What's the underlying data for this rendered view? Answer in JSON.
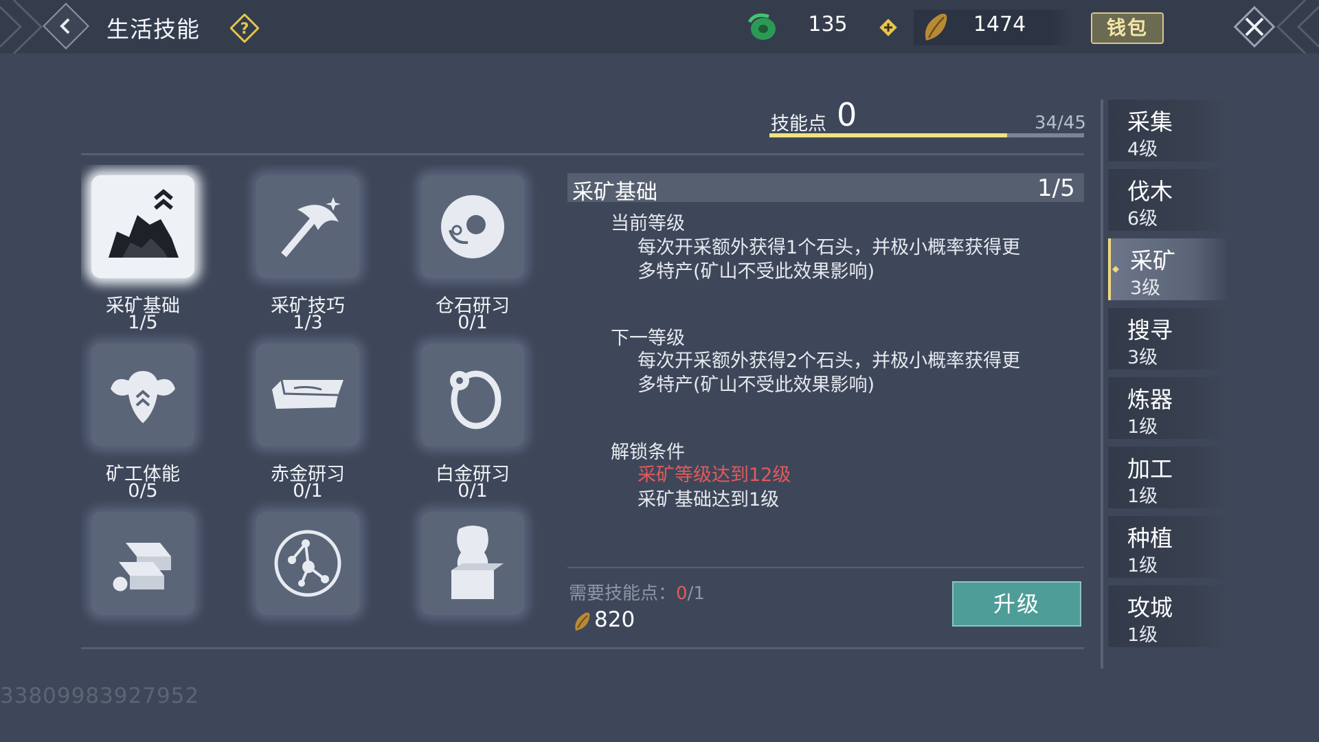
{
  "header": {
    "title": "生活技能",
    "currency_jade": "135",
    "currency_seed": "1474",
    "wallet_label": "钱包"
  },
  "skill_points": {
    "label": "技能点",
    "value": "0",
    "progress_text": "34/45",
    "progress_fraction": 0.756
  },
  "skills": [
    {
      "name": "采矿基础",
      "level": "1/5",
      "icon": "ore-pile-icon",
      "selected": true
    },
    {
      "name": "采矿技巧",
      "level": "1/3",
      "icon": "pickaxe-icon"
    },
    {
      "name": "仓石研习",
      "level": "0/1",
      "icon": "jade-disc-icon"
    },
    {
      "name": "矿工体能",
      "level": "0/5",
      "icon": "muscle-icon"
    },
    {
      "name": "赤金研习",
      "level": "0/1",
      "icon": "gold-bar-icon"
    },
    {
      "name": "白金研习",
      "level": "0/1",
      "icon": "ring-icon"
    },
    {
      "name": "",
      "level": "",
      "icon": "gold-ingots-icon"
    },
    {
      "name": "",
      "level": "",
      "icon": "constellation-icon"
    },
    {
      "name": "",
      "level": "",
      "icon": "lion-statue-icon"
    }
  ],
  "detail": {
    "title": "采矿基础",
    "level": "1/5",
    "current_label": "当前等级",
    "current_text": "每次开采额外获得1个石头，并极小概率获得更多特产(矿山不受此效果影响)",
    "next_label": "下一等级",
    "next_text": "每次开采额外获得2个石头，并极小概率获得更多特产(矿山不受此效果影响)",
    "unlock_label": "解锁条件",
    "unlock_conditions": [
      {
        "text": "采矿等级达到12级",
        "met": false
      },
      {
        "text": "采矿基础达到1级",
        "met": true
      }
    ],
    "need_label": "需要技能点：",
    "need_current": "0",
    "need_total": "1",
    "cost": "820",
    "upgrade_label": "升级"
  },
  "tabs": [
    {
      "name": "采集",
      "level": "4级"
    },
    {
      "name": "伐木",
      "level": "6级"
    },
    {
      "name": "采矿",
      "level": "3级",
      "active": true
    },
    {
      "name": "搜寻",
      "level": "3级"
    },
    {
      "name": "炼器",
      "level": "1级"
    },
    {
      "name": "加工",
      "level": "1级"
    },
    {
      "name": "种植",
      "level": "1级"
    },
    {
      "name": "攻城",
      "level": "1级"
    }
  ],
  "footer_id": "33809983927952",
  "colors": {
    "background": "#3e4759",
    "accent_gold": "#f2e27d",
    "upgrade_teal": "#4f9d98",
    "warning_red": "#e25a5a"
  }
}
